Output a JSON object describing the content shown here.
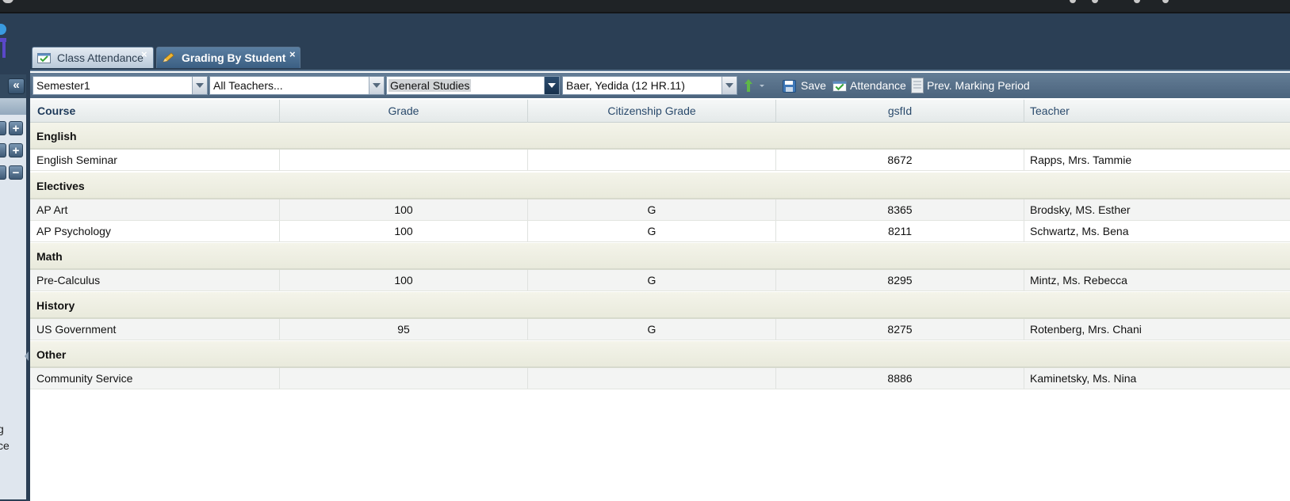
{
  "tabs": [
    {
      "label": "Class Attendance",
      "close": "×"
    },
    {
      "label": "Grading By Student",
      "close": "×"
    }
  ],
  "toolbar": {
    "period": "Semester1",
    "teacher": "All Teachers...",
    "category": "General Studies",
    "student": "Baer, Yedida (12 HR.11)",
    "save_label": "Save",
    "attendance_label": "Attendance",
    "prev_label": "Prev. Marking Period"
  },
  "sidebar": {
    "collapse": "«",
    "buttons": [
      "+",
      "+",
      "−"
    ],
    "fragments": [
      "g",
      "ce"
    ]
  },
  "columns": [
    "Course",
    "Grade",
    "Citizenship Grade",
    "gsfId",
    "Teacher"
  ],
  "groups": [
    {
      "name": "English",
      "rows": [
        {
          "course": "English Seminar",
          "grade": "",
          "citizenship": "",
          "gsfid": "8672",
          "teacher": "Rapps, Mrs. Tammie"
        }
      ]
    },
    {
      "name": "Electives",
      "rows": [
        {
          "course": "AP Art",
          "grade": "100",
          "citizenship": "G",
          "gsfid": "8365",
          "teacher": "Brodsky, MS. Esther"
        },
        {
          "course": "AP Psychology",
          "grade": "100",
          "citizenship": "G",
          "gsfid": "8211",
          "teacher": "Schwartz, Ms. Bena"
        }
      ]
    },
    {
      "name": "Math",
      "rows": [
        {
          "course": "Pre-Calculus",
          "grade": "100",
          "citizenship": "G",
          "gsfid": "8295",
          "teacher": "Mintz, Ms. Rebecca"
        }
      ]
    },
    {
      "name": "History",
      "rows": [
        {
          "course": "US Government",
          "grade": "95",
          "citizenship": "G",
          "gsfid": "8275",
          "teacher": "Rotenberg, Mrs. Chani"
        }
      ]
    },
    {
      "name": "Other",
      "rows": [
        {
          "course": "Community Service",
          "grade": "",
          "citizenship": "",
          "gsfid": "8886",
          "teacher": "Kaminetsky, Ms. Nina"
        }
      ]
    }
  ]
}
